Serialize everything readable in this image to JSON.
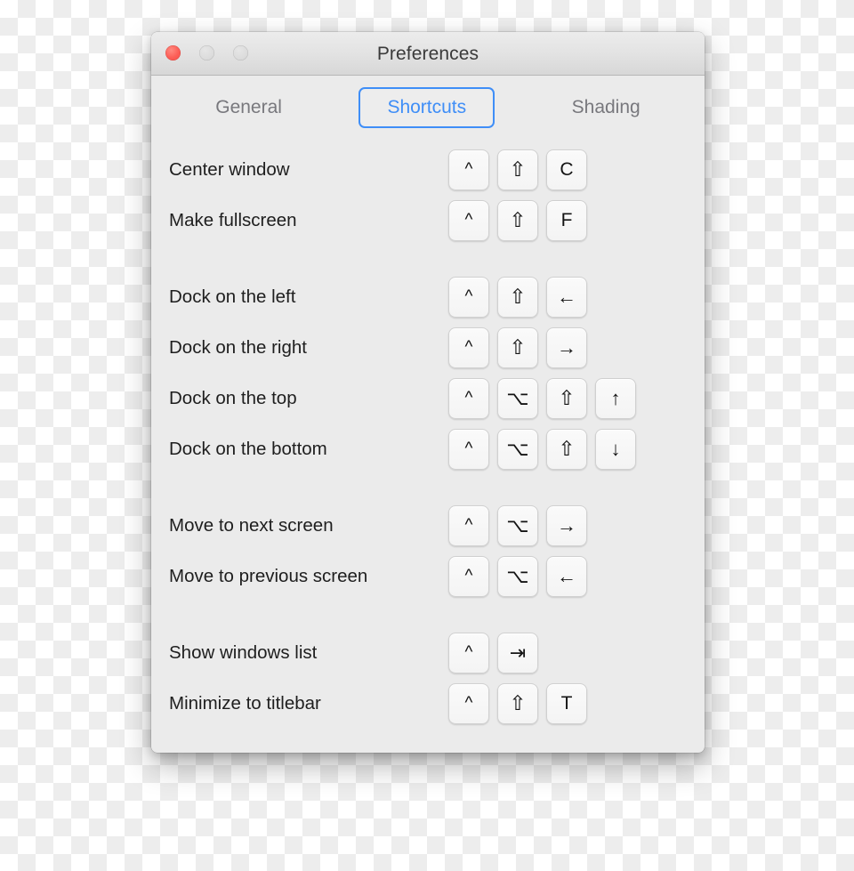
{
  "window": {
    "title": "Preferences",
    "traffic_lights": [
      {
        "name": "close",
        "color": "#fc5d56",
        "active": true
      },
      {
        "name": "minimize",
        "color": "#dcdcdc",
        "active": false
      },
      {
        "name": "zoom",
        "color": "#dcdcdc",
        "active": false
      }
    ]
  },
  "tabs": [
    {
      "label": "General",
      "selected": false
    },
    {
      "label": "Shortcuts",
      "selected": true
    },
    {
      "label": "Shading",
      "selected": false
    }
  ],
  "colors": {
    "accent": "#3f8ef7",
    "window_background": "#ebebeb",
    "titlebar_top": "#ececec",
    "titlebar_bottom": "#d7d7d7",
    "label_text": "#1e1e1e",
    "inactive_tab_text": "#78787d",
    "key_face": "#f6f6f6",
    "delete_icon": "#2b2b2b"
  },
  "glyphs": {
    "control": "^",
    "shift": "⇧",
    "option": "⌥",
    "tab": "⇥",
    "arrow_left": "←",
    "arrow_right": "→",
    "arrow_up": "↑",
    "arrow_down": "↓",
    "delete": "✕"
  },
  "shortcut_groups": [
    {
      "rows": [
        {
          "label": "Center window",
          "keys": [
            {
              "glyph": "^",
              "kind": "control"
            },
            {
              "glyph": "⇧",
              "kind": "shift"
            },
            {
              "glyph": "C",
              "kind": "letter"
            }
          ],
          "delete_label": "✕"
        },
        {
          "label": "Make fullscreen",
          "keys": [
            {
              "glyph": "^",
              "kind": "control"
            },
            {
              "glyph": "⇧",
              "kind": "shift"
            },
            {
              "glyph": "F",
              "kind": "letter"
            }
          ],
          "delete_label": "✕"
        }
      ]
    },
    {
      "rows": [
        {
          "label": "Dock on the left",
          "keys": [
            {
              "glyph": "^",
              "kind": "control"
            },
            {
              "glyph": "⇧",
              "kind": "shift"
            },
            {
              "glyph": "←",
              "kind": "arrow"
            }
          ],
          "delete_label": "✕"
        },
        {
          "label": "Dock on the right",
          "keys": [
            {
              "glyph": "^",
              "kind": "control"
            },
            {
              "glyph": "⇧",
              "kind": "shift"
            },
            {
              "glyph": "→",
              "kind": "arrow"
            }
          ],
          "delete_label": "✕"
        },
        {
          "label": "Dock on the top",
          "keys": [
            {
              "glyph": "^",
              "kind": "control"
            },
            {
              "glyph": "⌥",
              "kind": "option"
            },
            {
              "glyph": "⇧",
              "kind": "shift"
            },
            {
              "glyph": "↑",
              "kind": "arrow"
            }
          ],
          "delete_label": "✕"
        },
        {
          "label": "Dock on the bottom",
          "keys": [
            {
              "glyph": "^",
              "kind": "control"
            },
            {
              "glyph": "⌥",
              "kind": "option"
            },
            {
              "glyph": "⇧",
              "kind": "shift"
            },
            {
              "glyph": "↓",
              "kind": "arrow"
            }
          ],
          "delete_label": "✕"
        }
      ]
    },
    {
      "rows": [
        {
          "label": "Move to next screen",
          "keys": [
            {
              "glyph": "^",
              "kind": "control"
            },
            {
              "glyph": "⌥",
              "kind": "option"
            },
            {
              "glyph": "→",
              "kind": "arrow"
            }
          ],
          "delete_label": "✕"
        },
        {
          "label": "Move to previous screen",
          "keys": [
            {
              "glyph": "^",
              "kind": "control"
            },
            {
              "glyph": "⌥",
              "kind": "option"
            },
            {
              "glyph": "←",
              "kind": "arrow"
            }
          ],
          "delete_label": "✕"
        }
      ]
    },
    {
      "rows": [
        {
          "label": "Show windows list",
          "keys": [
            {
              "glyph": "^",
              "kind": "control"
            },
            {
              "glyph": "⇥",
              "kind": "tab"
            }
          ],
          "delete_label": "✕"
        },
        {
          "label": "Minimize to titlebar",
          "keys": [
            {
              "glyph": "^",
              "kind": "control"
            },
            {
              "glyph": "⇧",
              "kind": "shift"
            },
            {
              "glyph": "T",
              "kind": "letter"
            }
          ],
          "delete_label": "✕"
        }
      ]
    }
  ]
}
